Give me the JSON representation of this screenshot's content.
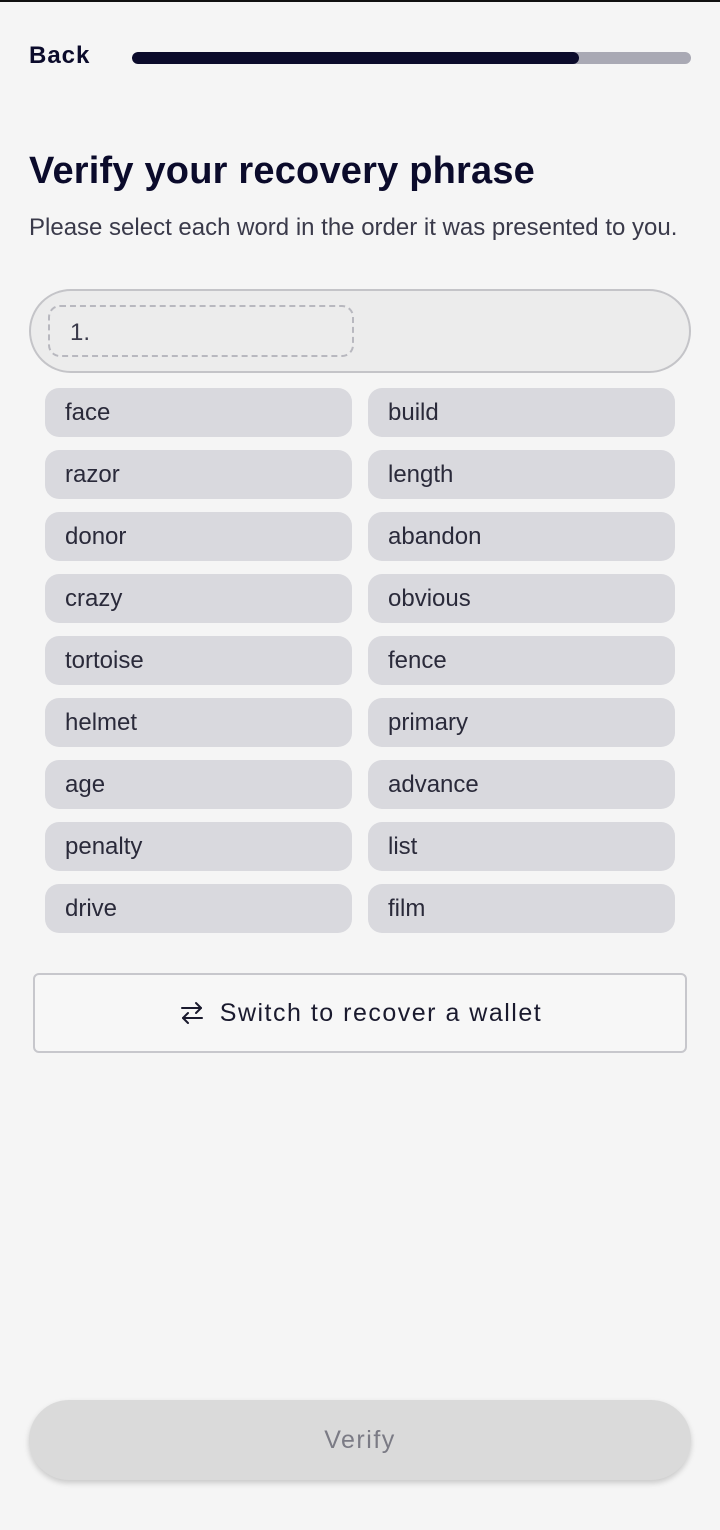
{
  "header": {
    "back_label": "Back",
    "progress_percent": 80
  },
  "main": {
    "title": "Verify your recovery phrase",
    "subtitle": "Please select each word in the order it was presented to you.",
    "slot_label": "1.",
    "words": [
      "face",
      "build",
      "razor",
      "length",
      "donor",
      "abandon",
      "crazy",
      "obvious",
      "tortoise",
      "fence",
      "helmet",
      "primary",
      "age",
      "advance",
      "penalty",
      "list",
      "drive",
      "film"
    ]
  },
  "switch_button": {
    "label": "Switch to recover a wallet",
    "icon": "swap-arrows-icon"
  },
  "footer": {
    "verify_label": "Verify"
  },
  "colors": {
    "primary": "#0b0b2b",
    "chip": "#d9d9de",
    "background": "#f5f5f5",
    "disabled_button": "#dadada"
  }
}
